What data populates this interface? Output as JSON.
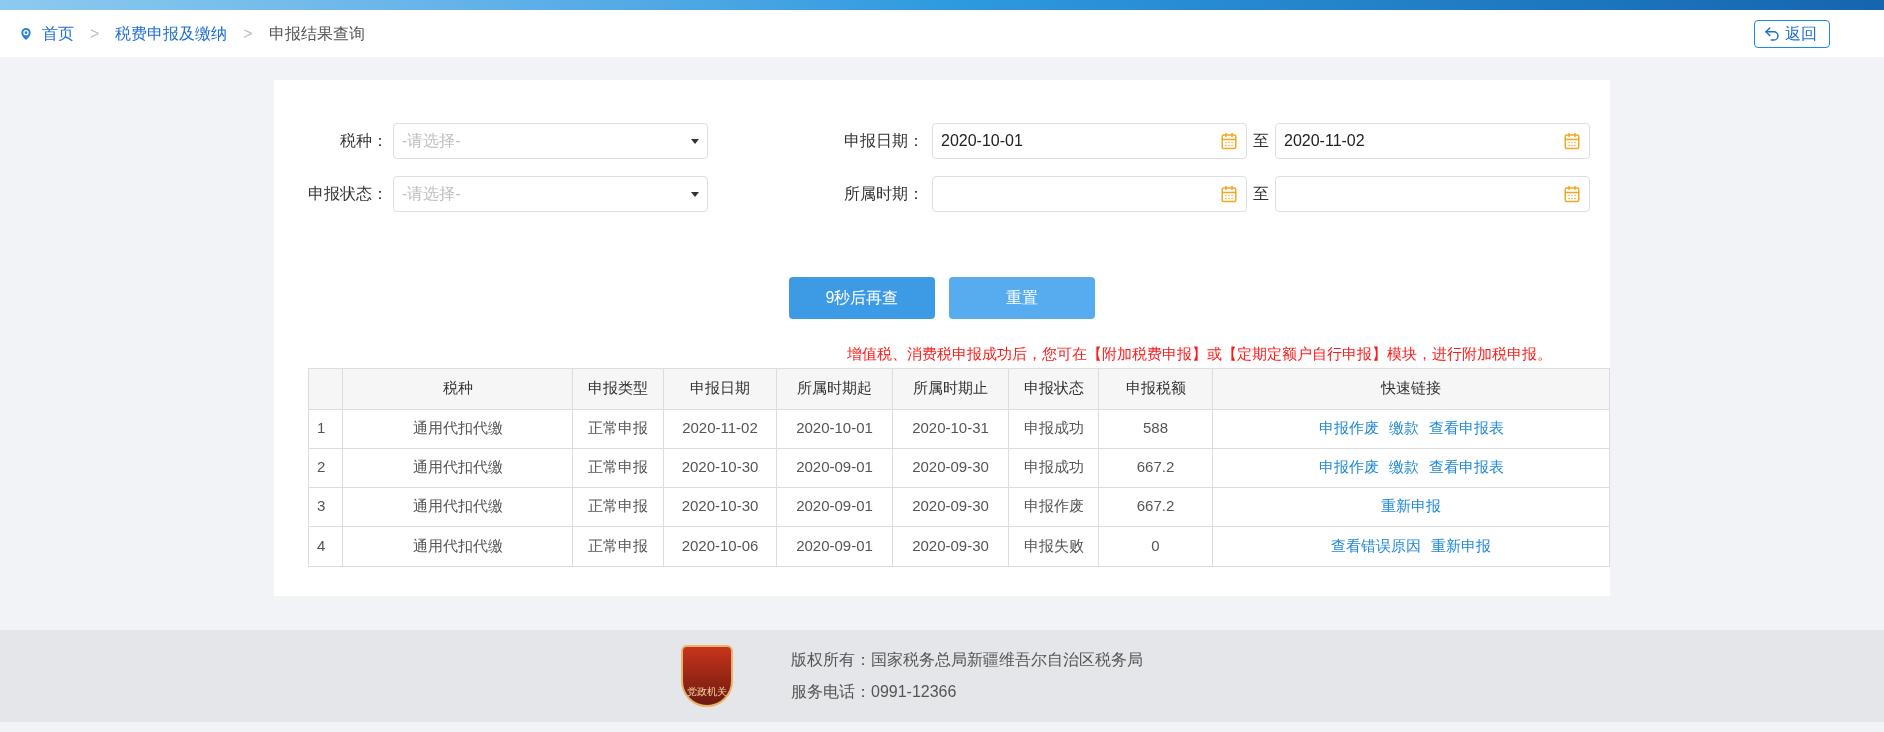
{
  "breadcrumb": {
    "separator": ">",
    "items": [
      {
        "label": "首页",
        "link": true
      },
      {
        "label": "税费申报及缴纳",
        "link": true
      },
      {
        "label": "申报结果查询",
        "link": false
      }
    ]
  },
  "back_button": {
    "label": "返回"
  },
  "filters": {
    "left": [
      {
        "label": "税种：",
        "placeholder": "-请选择-"
      },
      {
        "label": "申报状态：",
        "placeholder": "-请选择-"
      }
    ],
    "right": [
      {
        "label": "申报日期：",
        "from": "2020-10-01",
        "to": "2020-11-02",
        "separator": "至"
      },
      {
        "label": "所属时期：",
        "separator": "至"
      }
    ]
  },
  "buttons": [
    {
      "label": "9秒后再查",
      "kind": "primary"
    },
    {
      "label": "重置",
      "kind": "secondary"
    }
  ],
  "notice": "增值税、消费税申报成功后，您可在【附加税费申报】或【定期定额户自行申报】模块，进行附加税申报。",
  "table": {
    "columns": [
      "",
      "税种",
      "申报类型",
      "申报日期",
      "所属时期起",
      "所属时期止",
      "申报状态",
      "申报税额",
      "快速链接"
    ],
    "rows": [
      {
        "cells": [
          "1",
          "通用代扣代缴",
          "正常申报",
          "2020-11-02",
          "2020-10-01",
          "2020-10-31",
          "申报成功",
          "588"
        ],
        "links": [
          "申报作废",
          "缴款",
          "查看申报表"
        ]
      },
      {
        "cells": [
          "2",
          "通用代扣代缴",
          "正常申报",
          "2020-10-30",
          "2020-09-01",
          "2020-09-30",
          "申报成功",
          "667.2"
        ],
        "links": [
          "申报作废",
          "缴款",
          "查看申报表"
        ]
      },
      {
        "cells": [
          "3",
          "通用代扣代缴",
          "正常申报",
          "2020-10-30",
          "2020-09-01",
          "2020-09-30",
          "申报作废",
          "667.2"
        ],
        "links": [
          "重新申报"
        ]
      },
      {
        "cells": [
          "4",
          "通用代扣代缴",
          "正常申报",
          "2020-10-06",
          "2020-09-01",
          "2020-09-30",
          "申报失败",
          "0"
        ],
        "links": [
          "查看错误原因",
          "重新申报"
        ]
      }
    ]
  },
  "footer": {
    "badge_text": "党政机关",
    "lines": [
      "版权所有：国家税务总局新疆维吾尔自治区税务局",
      "服务电话：0991-12366"
    ]
  }
}
